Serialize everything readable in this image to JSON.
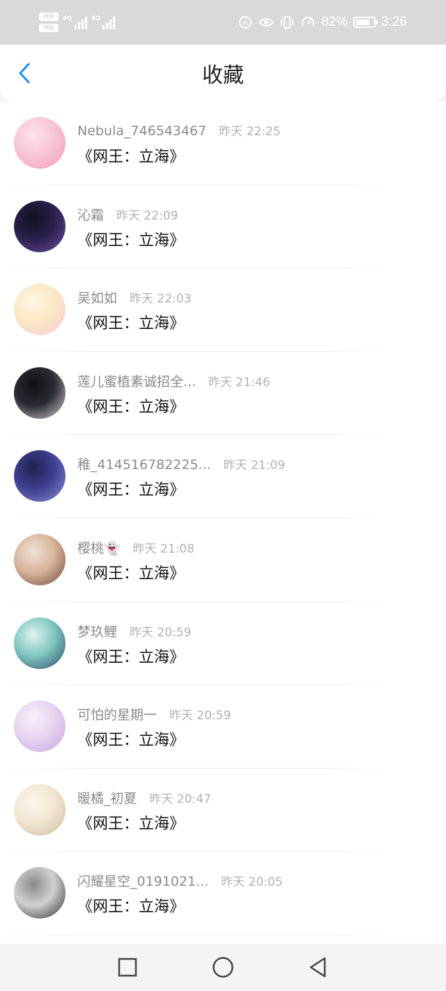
{
  "status_bar": {
    "network_labels": [
      "HD",
      "HD"
    ],
    "signal_1_label": "4G",
    "signal_2_label": "4G",
    "battery_percent": "82%",
    "battery_level": 0.82,
    "time": "3:26",
    "icons": [
      "nfc-icon",
      "eye-icon",
      "vibrate-icon",
      "speed-icon",
      "battery-icon"
    ]
  },
  "header": {
    "title": "收藏",
    "back_icon": "chevron-left-icon",
    "accent": "#1a8cff"
  },
  "favorites": [
    {
      "user": "Nebula_746543467",
      "time": "昨天 22:25",
      "title": "《网王：立海》",
      "avatar_colors": [
        "#f7c6d4",
        "#f29bb6",
        "#fde2ea"
      ]
    },
    {
      "user": "沁霜",
      "time": "昨天 22:09",
      "title": "《网王：立海》",
      "avatar_colors": [
        "#2a1f4a",
        "#6b4ea6",
        "#111122"
      ]
    },
    {
      "user": "吴如如",
      "time": "昨天 22:03",
      "title": "《网王：立海》",
      "avatar_colors": [
        "#fbe8c4",
        "#f7c9d9",
        "#fff6e6"
      ]
    },
    {
      "user": "莲儿蜜植素诚招全...",
      "time": "昨天 21:46",
      "title": "《网王：立海》",
      "avatar_colors": [
        "#2b2b33",
        "#d9d4d6",
        "#111116"
      ]
    },
    {
      "user": "稚_414516782225...",
      "time": "昨天 21:09",
      "title": "《网王：立海》",
      "avatar_colors": [
        "#3e3f8f",
        "#8a8ed8",
        "#20224d"
      ]
    },
    {
      "user": "樱桃👻",
      "time": "昨天 21:08",
      "title": "《网王：立海》",
      "avatar_colors": [
        "#d8b59c",
        "#6b4b3b",
        "#efe2d6"
      ]
    },
    {
      "user": "梦玖鲤",
      "time": "昨天 20:59",
      "title": "《网王：立海》",
      "avatar_colors": [
        "#7fc7c0",
        "#2e4a6b",
        "#e0f2ef"
      ]
    },
    {
      "user": "可怕的星期一",
      "time": "昨天 20:59",
      "title": "《网王：立海》",
      "avatar_colors": [
        "#e6d3f0",
        "#c8a7e2",
        "#fbeef8"
      ]
    },
    {
      "user": "暖橘_初夏",
      "time": "昨天 20:47",
      "title": "《网王：立海》",
      "avatar_colors": [
        "#f3e7d3",
        "#c9b79c",
        "#fbf5ea"
      ]
    },
    {
      "user": "闪耀星空_0191021...",
      "time": "昨天 20:05",
      "title": "《网王：立海》",
      "avatar_colors": [
        "#d0d0d0",
        "#2a2a2a",
        "#8a8a8a"
      ]
    }
  ],
  "nav_bar": {
    "buttons": [
      "recent-apps-icon",
      "home-icon",
      "back-icon"
    ]
  }
}
